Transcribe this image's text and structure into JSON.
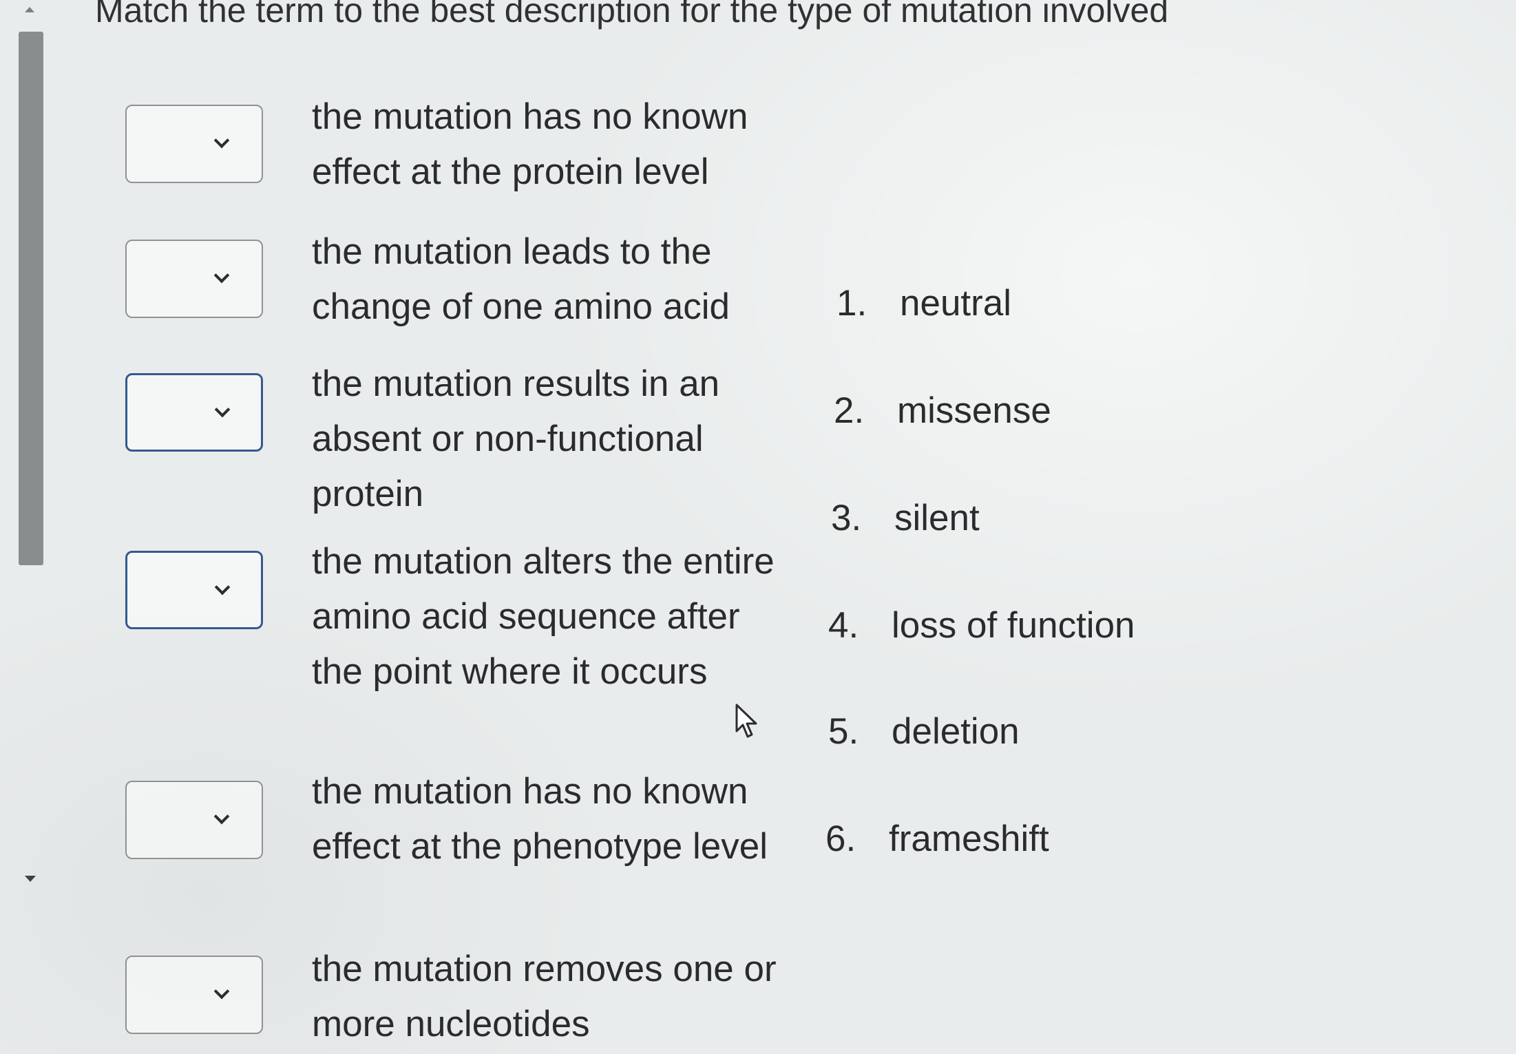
{
  "title": "Match the term to the best description for the type of mutation involved",
  "questions": [
    {
      "description": "the mutation has no known effect at the protein level",
      "selected": ""
    },
    {
      "description": "the mutation leads to the change of one amino acid",
      "selected": ""
    },
    {
      "description": "the mutation results in an absent or non-functional protein",
      "selected": ""
    },
    {
      "description": "the mutation alters the entire amino acid sequence after the point where it occurs",
      "selected": ""
    },
    {
      "description": "the mutation has no known effect at the phenotype level",
      "selected": ""
    },
    {
      "description": "the mutation removes one or more nucleotides",
      "selected": ""
    }
  ],
  "answers": [
    {
      "number": "1.",
      "label": "neutral"
    },
    {
      "number": "2.",
      "label": "missense"
    },
    {
      "number": "3.",
      "label": "silent"
    },
    {
      "number": "4.",
      "label": "loss of function"
    },
    {
      "number": "5.",
      "label": "deletion"
    },
    {
      "number": "6.",
      "label": "frameshift"
    }
  ],
  "icons": {
    "dropdown": "chevron-down-icon",
    "cursor": "mouse-pointer-icon",
    "scroll_up": "scroll-up-arrow-icon",
    "scroll_down": "scroll-down-arrow-icon"
  },
  "colors": {
    "active_border": "#35598f",
    "inactive_border": "#8f9295",
    "text": "#2a2b2d"
  }
}
